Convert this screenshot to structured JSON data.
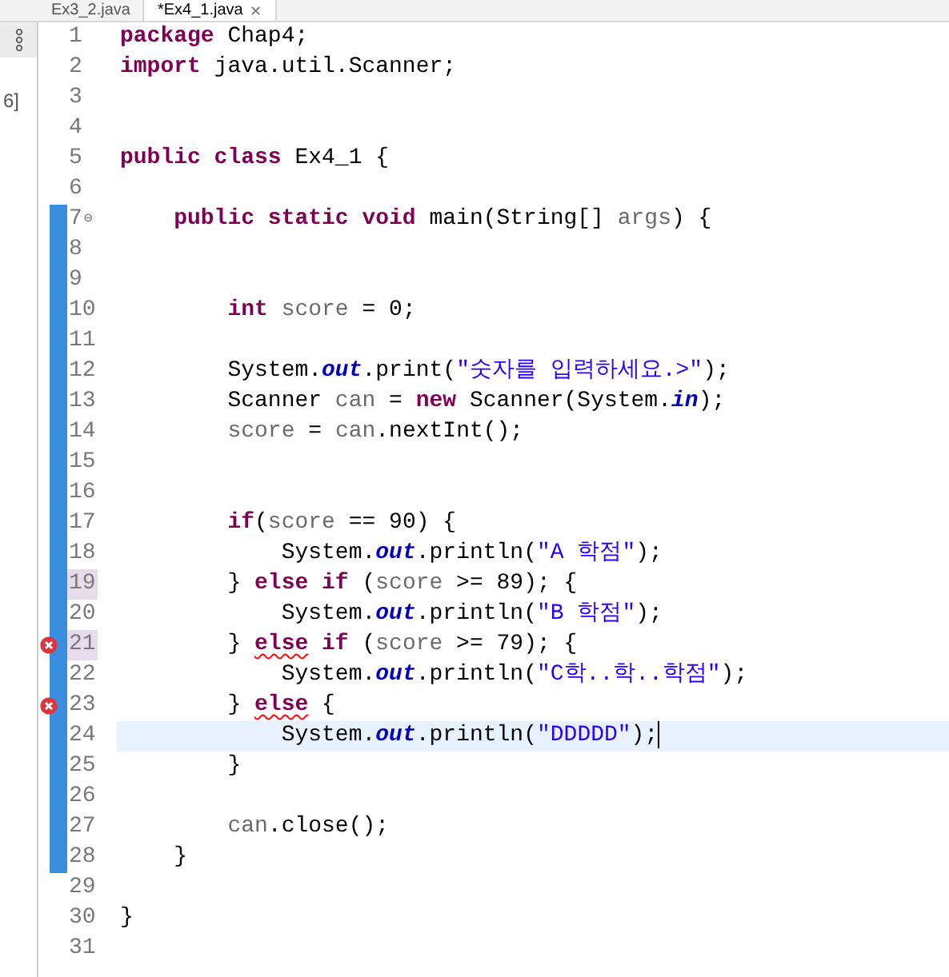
{
  "side_panel": {
    "text": "6]"
  },
  "tabs": [
    {
      "label": "Ex3_2.java",
      "selected": false
    },
    {
      "label": "*Ex4_1.java",
      "selected": true,
      "close": "✕"
    }
  ],
  "lines": [
    {
      "n": "1",
      "changed": false,
      "occurrence": false,
      "error": false,
      "current": false,
      "tokens": [
        {
          "kind": "kw",
          "text": "package "
        },
        {
          "kind": "plain",
          "text": "Chap4;"
        }
      ]
    },
    {
      "n": "2",
      "changed": false,
      "occurrence": false,
      "error": false,
      "current": false,
      "tokens": [
        {
          "kind": "kw",
          "text": "import "
        },
        {
          "kind": "plain",
          "text": "java.util.Scanner;"
        }
      ]
    },
    {
      "n": "3",
      "changed": false,
      "occurrence": false,
      "error": false,
      "current": false
    },
    {
      "n": "4",
      "changed": false,
      "occurrence": false,
      "error": false,
      "current": false
    },
    {
      "n": "5",
      "changed": false,
      "occurrence": false,
      "error": false,
      "current": false,
      "tokens": [
        {
          "kind": "kw",
          "text": "public class "
        },
        {
          "kind": "plain",
          "text": "Ex4_1 {"
        }
      ]
    },
    {
      "n": "6",
      "changed": false,
      "occurrence": false,
      "error": false,
      "current": false
    },
    {
      "n": "7",
      "fold": "⊖",
      "changed": true,
      "occurrence": false,
      "error": false,
      "current": false,
      "tokens": [
        {
          "kind": "kw",
          "text": "    public static void "
        },
        {
          "kind": "plain",
          "text": "main(String[] "
        },
        {
          "kind": "var",
          "text": "args"
        },
        {
          "kind": "plain",
          "text": ") {"
        }
      ]
    },
    {
      "n": "8",
      "changed": true,
      "occurrence": false,
      "error": false,
      "current": false
    },
    {
      "n": "9",
      "changed": true,
      "occurrence": false,
      "error": false,
      "current": false
    },
    {
      "n": "10",
      "changed": true,
      "occurrence": false,
      "error": false,
      "current": false,
      "tokens": [
        {
          "kind": "kw",
          "text": "        int "
        },
        {
          "kind": "var",
          "text": "score"
        },
        {
          "kind": "plain",
          "text": " = 0;"
        }
      ]
    },
    {
      "n": "11",
      "changed": true,
      "occurrence": false,
      "error": false,
      "current": false
    },
    {
      "n": "12",
      "changed": true,
      "occurrence": false,
      "error": false,
      "current": false,
      "tokens": [
        {
          "kind": "plain",
          "text": "        System."
        },
        {
          "kind": "field",
          "text": "out"
        },
        {
          "kind": "plain",
          "text": ".print("
        },
        {
          "kind": "str",
          "text": "\"숫자를 입력하세요.>\""
        },
        {
          "kind": "plain",
          "text": ");"
        }
      ]
    },
    {
      "n": "13",
      "changed": true,
      "occurrence": false,
      "error": false,
      "current": false,
      "tokens": [
        {
          "kind": "plain",
          "text": "        Scanner "
        },
        {
          "kind": "var",
          "text": "can"
        },
        {
          "kind": "plain",
          "text": " = "
        },
        {
          "kind": "kw",
          "text": "new "
        },
        {
          "kind": "plain",
          "text": "Scanner(System."
        },
        {
          "kind": "field",
          "text": "in"
        },
        {
          "kind": "plain",
          "text": ");"
        }
      ]
    },
    {
      "n": "14",
      "changed": true,
      "occurrence": false,
      "error": false,
      "current": false,
      "tokens": [
        {
          "kind": "var",
          "text": "        score"
        },
        {
          "kind": "plain",
          "text": " = "
        },
        {
          "kind": "var",
          "text": "can"
        },
        {
          "kind": "plain",
          "text": ".nextInt();"
        }
      ]
    },
    {
      "n": "15",
      "changed": true,
      "occurrence": false,
      "error": false,
      "current": false
    },
    {
      "n": "16",
      "changed": true,
      "occurrence": false,
      "error": false,
      "current": false
    },
    {
      "n": "17",
      "changed": true,
      "occurrence": false,
      "error": false,
      "current": false,
      "tokens": [
        {
          "kind": "kw",
          "text": "        if"
        },
        {
          "kind": "plain",
          "text": "("
        },
        {
          "kind": "var",
          "text": "score"
        },
        {
          "kind": "plain",
          "text": " == 90) {"
        }
      ]
    },
    {
      "n": "18",
      "changed": true,
      "occurrence": false,
      "error": false,
      "current": false,
      "tokens": [
        {
          "kind": "plain",
          "text": "            System."
        },
        {
          "kind": "field",
          "text": "out"
        },
        {
          "kind": "plain",
          "text": ".println("
        },
        {
          "kind": "str",
          "text": "\"A 학점\""
        },
        {
          "kind": "plain",
          "text": ");"
        }
      ]
    },
    {
      "n": "19",
      "changed": true,
      "occurrence": true,
      "error": false,
      "current": false,
      "tokens": [
        {
          "kind": "plain",
          "text": "        } "
        },
        {
          "kind": "kw",
          "text": "else if "
        },
        {
          "kind": "plain",
          "text": "("
        },
        {
          "kind": "var",
          "text": "score"
        },
        {
          "kind": "plain",
          "text": " >= 89); {"
        }
      ]
    },
    {
      "n": "20",
      "changed": true,
      "occurrence": false,
      "error": false,
      "current": false,
      "tokens": [
        {
          "kind": "plain",
          "text": "            System."
        },
        {
          "kind": "field",
          "text": "out"
        },
        {
          "kind": "plain",
          "text": ".println("
        },
        {
          "kind": "str",
          "text": "\"B 학점\""
        },
        {
          "kind": "plain",
          "text": ");"
        }
      ]
    },
    {
      "n": "21",
      "changed": true,
      "occurrence": true,
      "error": true,
      "current": false,
      "tokens": [
        {
          "kind": "plain",
          "text": "        } "
        },
        {
          "kind": "kw_error",
          "text": "else"
        },
        {
          "kind": "kw",
          "text": " if "
        },
        {
          "kind": "plain",
          "text": "("
        },
        {
          "kind": "var",
          "text": "score"
        },
        {
          "kind": "plain",
          "text": " >= 79); {"
        }
      ]
    },
    {
      "n": "22",
      "changed": true,
      "occurrence": false,
      "error": false,
      "current": false,
      "tokens": [
        {
          "kind": "plain",
          "text": "            System."
        },
        {
          "kind": "field",
          "text": "out"
        },
        {
          "kind": "plain",
          "text": ".println("
        },
        {
          "kind": "str",
          "text": "\"C학..학..학점\""
        },
        {
          "kind": "plain",
          "text": ");"
        }
      ]
    },
    {
      "n": "23",
      "changed": true,
      "occurrence": false,
      "error": true,
      "current": false,
      "tokens": [
        {
          "kind": "plain",
          "text": "        } "
        },
        {
          "kind": "kw_error",
          "text": "else"
        },
        {
          "kind": "plain",
          "text": " {"
        }
      ]
    },
    {
      "n": "24",
      "changed": true,
      "occurrence": false,
      "error": false,
      "current": true,
      "tokens": [
        {
          "kind": "plain",
          "text": "            System."
        },
        {
          "kind": "field",
          "text": "out"
        },
        {
          "kind": "plain",
          "text": ".println("
        },
        {
          "kind": "str",
          "text": "\"DDDDD\""
        },
        {
          "kind": "plain",
          "text": ");"
        }
      ]
    },
    {
      "n": "25",
      "changed": true,
      "occurrence": false,
      "error": false,
      "current": false,
      "tokens": [
        {
          "kind": "plain",
          "text": "        }"
        }
      ]
    },
    {
      "n": "26",
      "changed": true,
      "occurrence": false,
      "error": false,
      "current": false
    },
    {
      "n": "27",
      "changed": true,
      "occurrence": false,
      "error": false,
      "current": false,
      "tokens": [
        {
          "kind": "var",
          "text": "        can"
        },
        {
          "kind": "plain",
          "text": ".close();"
        }
      ]
    },
    {
      "n": "28",
      "changed": true,
      "occurrence": false,
      "error": false,
      "current": false,
      "tokens": [
        {
          "kind": "plain",
          "text": "    }"
        }
      ]
    },
    {
      "n": "29",
      "changed": false,
      "occurrence": false,
      "error": false,
      "current": false
    },
    {
      "n": "30",
      "changed": false,
      "occurrence": false,
      "error": false,
      "current": false,
      "tokens": [
        {
          "kind": "plain",
          "text": "}"
        }
      ]
    },
    {
      "n": "31",
      "changed": false,
      "occurrence": false,
      "error": false,
      "current": false
    }
  ]
}
